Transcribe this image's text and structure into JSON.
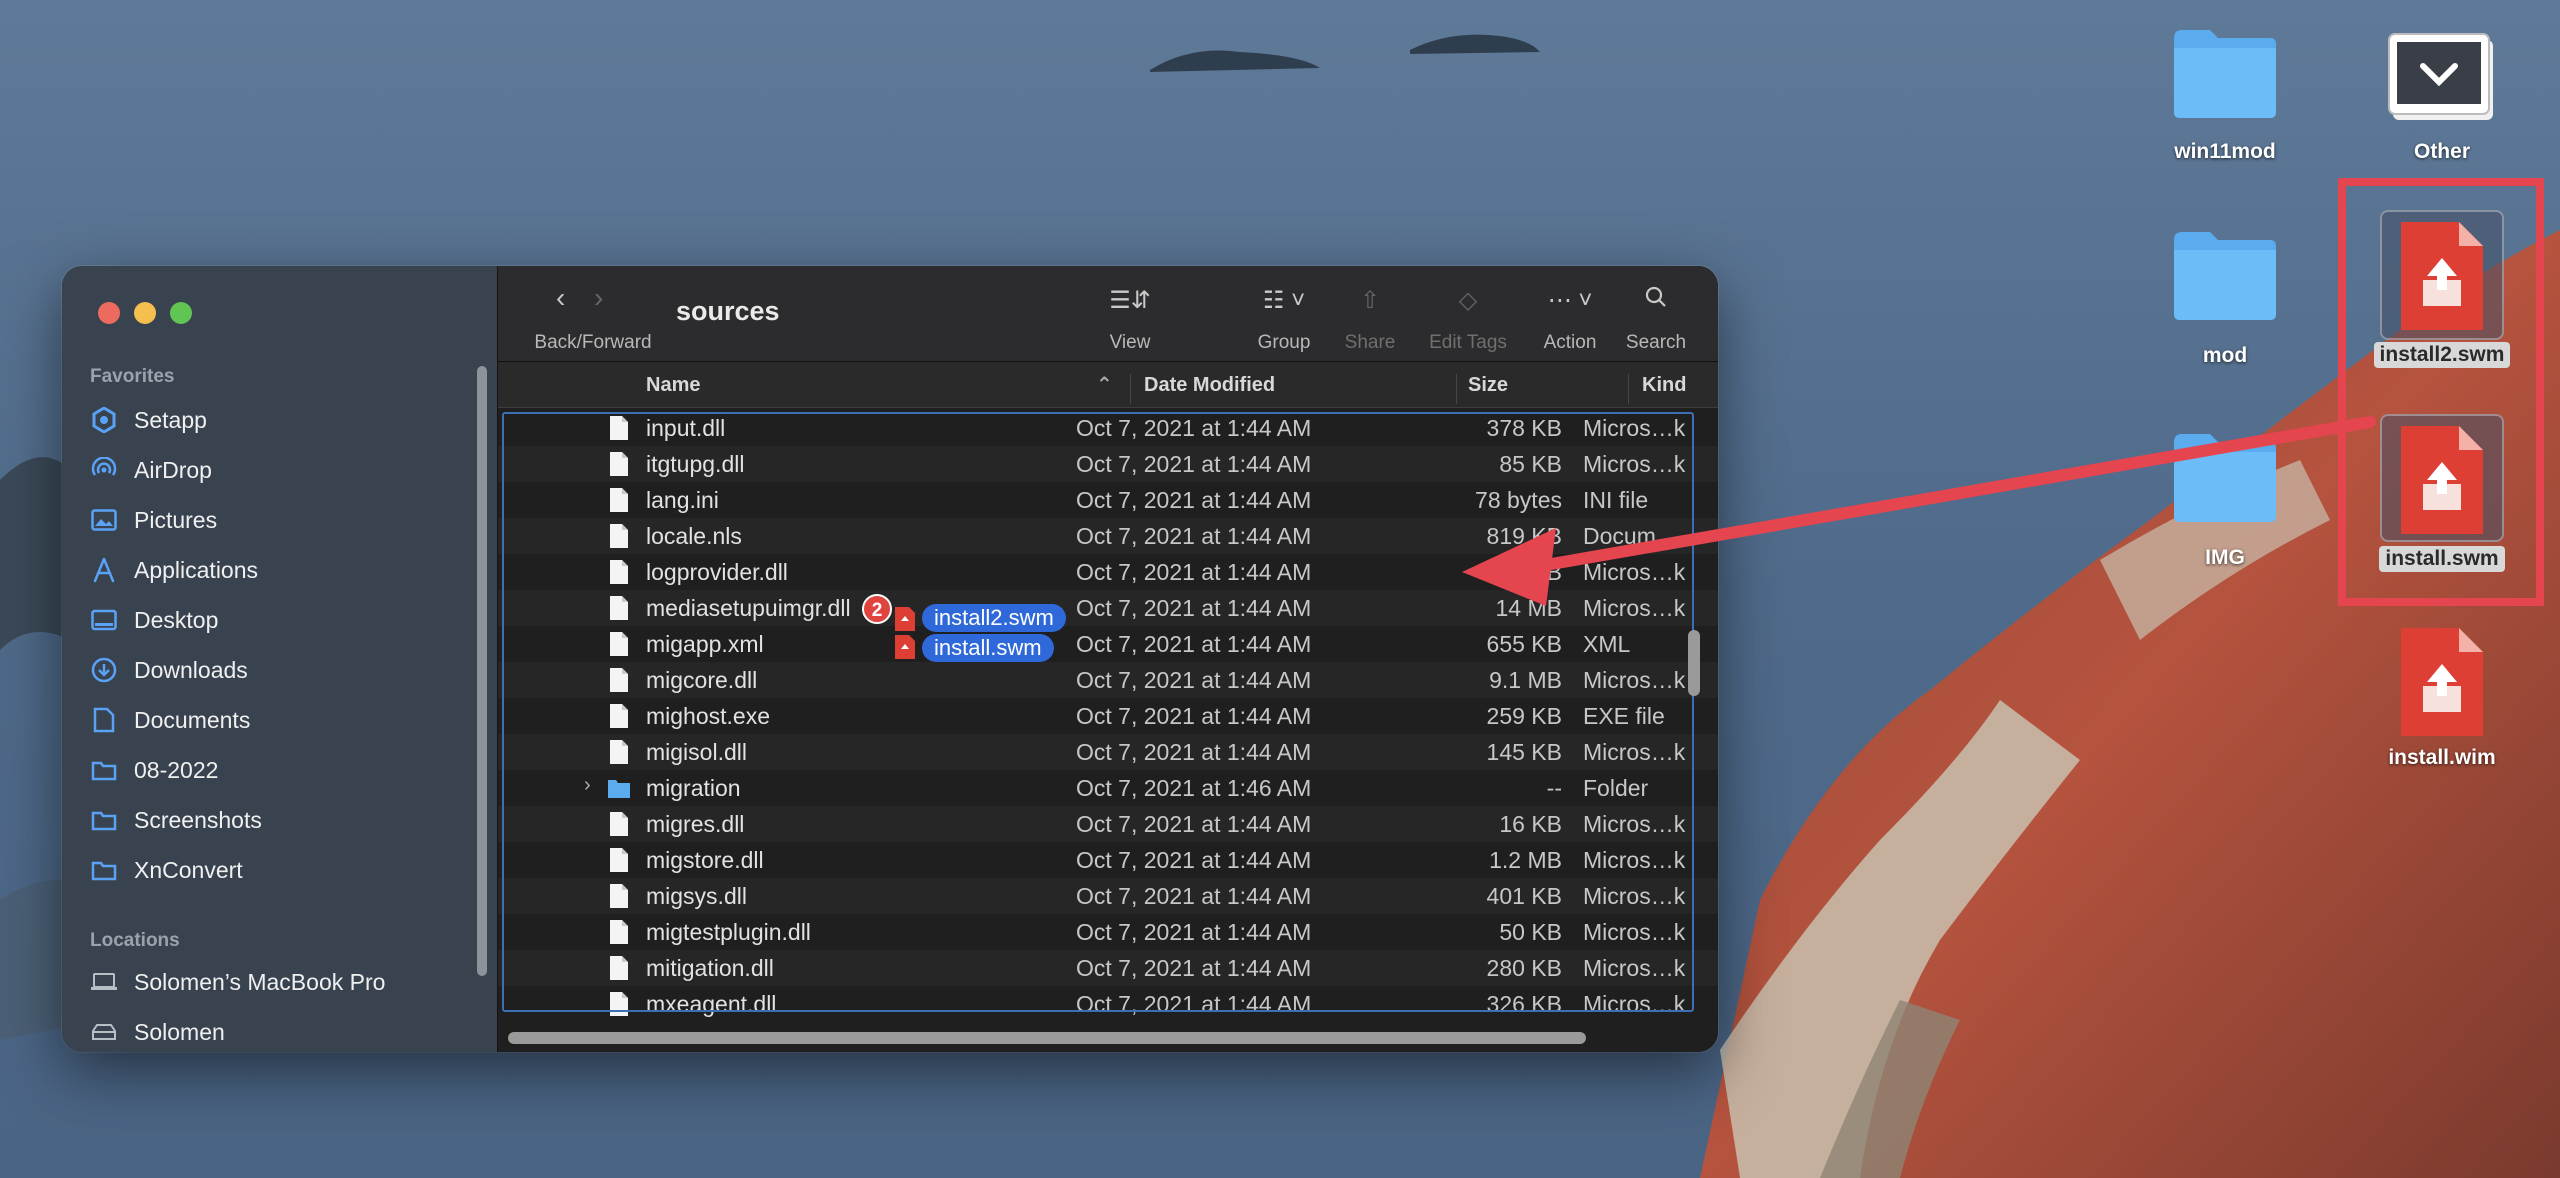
{
  "desktop": {
    "icons": [
      {
        "label": "win11mod",
        "type": "folder"
      },
      {
        "label": "Other",
        "type": "drive"
      },
      {
        "label": "mod",
        "type": "folder"
      },
      {
        "label": "install2.swm",
        "type": "document",
        "selected": true
      },
      {
        "label": "IMG",
        "type": "folder"
      },
      {
        "label": "install.swm",
        "type": "document",
        "selected": true
      },
      {
        "label": "install.wim",
        "type": "document"
      }
    ],
    "highlight_color": "#e5454f"
  },
  "finder": {
    "title": "sources",
    "toolbar": {
      "back_forward": "Back/Forward",
      "view": "View",
      "group": "Group",
      "share": "Share",
      "edit_tags": "Edit Tags",
      "action": "Action",
      "search": "Search"
    },
    "sidebar": {
      "favorites_heading": "Favorites",
      "favorites": [
        {
          "label": "Setapp",
          "icon": "setapp-icon"
        },
        {
          "label": "AirDrop",
          "icon": "airdrop-icon"
        },
        {
          "label": "Pictures",
          "icon": "pictures-icon"
        },
        {
          "label": "Applications",
          "icon": "applications-icon"
        },
        {
          "label": "Desktop",
          "icon": "desktop-icon"
        },
        {
          "label": "Downloads",
          "icon": "downloads-icon"
        },
        {
          "label": "Documents",
          "icon": "documents-icon"
        },
        {
          "label": "08-2022",
          "icon": "folder-icon"
        },
        {
          "label": "Screenshots",
          "icon": "folder-icon"
        },
        {
          "label": "XnConvert",
          "icon": "folder-icon"
        }
      ],
      "locations_heading": "Locations",
      "locations": [
        {
          "label": "Solomen’s MacBook Pro",
          "icon": "laptop-icon"
        },
        {
          "label": "Solomen",
          "icon": "disk-icon"
        }
      ]
    },
    "columns": {
      "name": "Name",
      "date": "Date Modified",
      "size": "Size",
      "kind": "Kind"
    },
    "rows": [
      {
        "name": "input.dll",
        "date": "Oct 7, 2021 at 1:44 AM",
        "size": "378 KB",
        "kind": "Micros…k"
      },
      {
        "name": "itgtupg.dll",
        "date": "Oct 7, 2021 at 1:44 AM",
        "size": "85 KB",
        "kind": "Micros…k"
      },
      {
        "name": "lang.ini",
        "date": "Oct 7, 2021 at 1:44 AM",
        "size": "78 bytes",
        "kind": "INI file"
      },
      {
        "name": "locale.nls",
        "date": "Oct 7, 2021 at 1:44 AM",
        "size": "819 KB",
        "kind": "Docum…"
      },
      {
        "name": "logprovider.dll",
        "date": "Oct 7, 2021 at 1:44 AM",
        "size": "KB",
        "kind": "Micros…k"
      },
      {
        "name": "mediasetupuimgr.dll",
        "date": "Oct 7, 2021 at 1:44 AM",
        "size": "14 MB",
        "kind": "Micros…k"
      },
      {
        "name": "migapp.xml",
        "date": "Oct 7, 2021 at 1:44 AM",
        "size": "655 KB",
        "kind": "XML"
      },
      {
        "name": "migcore.dll",
        "date": "Oct 7, 2021 at 1:44 AM",
        "size": "9.1 MB",
        "kind": "Micros…k"
      },
      {
        "name": "mighost.exe",
        "date": "Oct 7, 2021 at 1:44 AM",
        "size": "259 KB",
        "kind": "EXE file"
      },
      {
        "name": "migisol.dll",
        "date": "Oct 7, 2021 at 1:44 AM",
        "size": "145 KB",
        "kind": "Micros…k"
      },
      {
        "name": "migration",
        "date": "Oct 7, 2021 at 1:46 AM",
        "size": "--",
        "kind": "Folder"
      },
      {
        "name": "migres.dll",
        "date": "Oct 7, 2021 at 1:44 AM",
        "size": "16 KB",
        "kind": "Micros…k"
      },
      {
        "name": "migstore.dll",
        "date": "Oct 7, 2021 at 1:44 AM",
        "size": "1.2 MB",
        "kind": "Micros…k"
      },
      {
        "name": "migsys.dll",
        "date": "Oct 7, 2021 at 1:44 AM",
        "size": "401 KB",
        "kind": "Micros…k"
      },
      {
        "name": "migtestplugin.dll",
        "date": "Oct 7, 2021 at 1:44 AM",
        "size": "50 KB",
        "kind": "Micros…k"
      },
      {
        "name": "mitigation.dll",
        "date": "Oct 7, 2021 at 1:44 AM",
        "size": "280 KB",
        "kind": "Micros…k"
      },
      {
        "name": "mxeagent.dll",
        "date": "Oct 7, 2021 at 1:44 AM",
        "size": "326 KB",
        "kind": "Micros…k"
      }
    ],
    "drag": {
      "count": "2",
      "items": [
        "install2.swm",
        "install.swm"
      ]
    }
  }
}
